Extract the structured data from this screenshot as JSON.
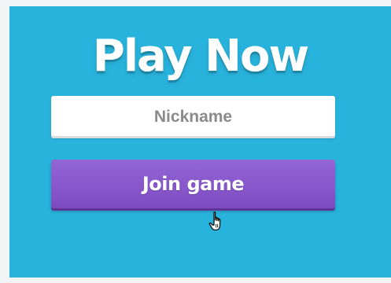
{
  "title": "Play Now",
  "nickname_input": {
    "value": "",
    "placeholder": "Nickname"
  },
  "join_button": {
    "label": "Join game"
  },
  "colors": {
    "panel_background": "#28b3dc",
    "button_purple": "#8757cb",
    "input_background": "#ffffff",
    "title_text": "#ffffff"
  },
  "cursor": {
    "icon": "hand-pointer-icon"
  }
}
